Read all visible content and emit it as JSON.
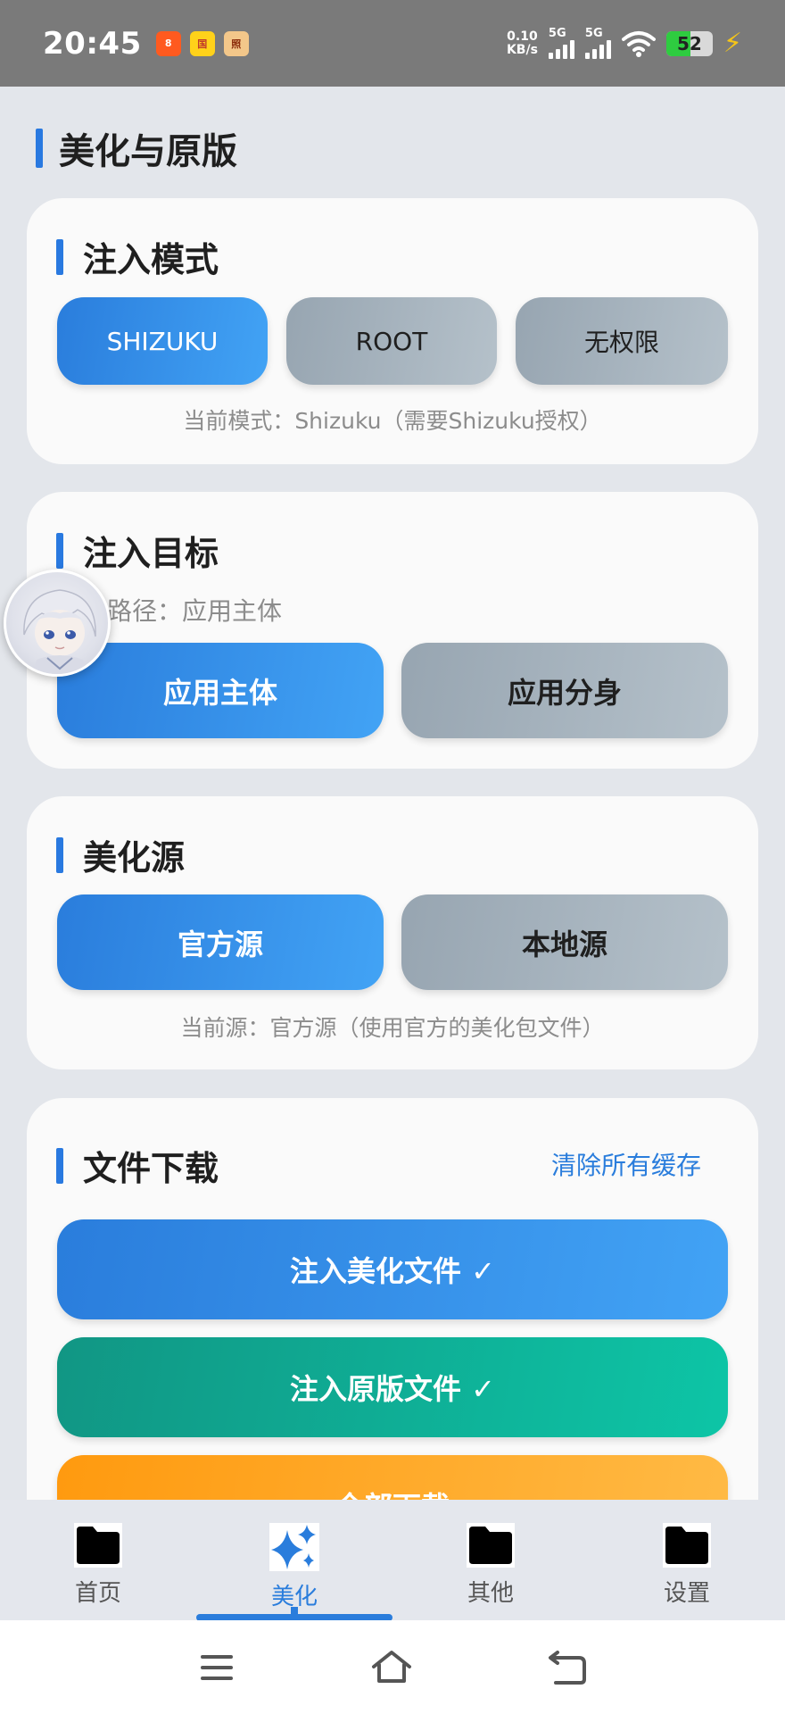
{
  "status_bar": {
    "time": "20:45",
    "apps": [
      "8",
      "国",
      "照"
    ],
    "net_speed_value": "0.10",
    "net_speed_unit": "KB/s",
    "sim1": "5G",
    "sim2": "5G",
    "battery": "52"
  },
  "page_title": "美化与原版",
  "inject_mode": {
    "title": "注入模式",
    "options": [
      "SHIZUKU",
      "ROOT",
      "无权限"
    ],
    "selected": "SHIZUKU",
    "hint": "当前模式：Shizuku（需要Shizuku授权）"
  },
  "inject_target": {
    "title": "注入目标",
    "path_hint": "路径：应用主体",
    "options": [
      "应用主体",
      "应用分身"
    ],
    "selected": "应用主体"
  },
  "beautify_source": {
    "title": "美化源",
    "options": [
      "官方源",
      "本地源"
    ],
    "selected": "官方源",
    "hint": "当前源：官方源（使用官方的美化包文件）"
  },
  "file_download": {
    "title": "文件下载",
    "clear_cache": "清除所有缓存",
    "inject_beautify": "注入美化文件 ✓",
    "inject_original": "注入原版文件 ✓",
    "download_all": "全部下载"
  },
  "bottom_nav": {
    "items": [
      "首页",
      "美化",
      "其他",
      "设置"
    ],
    "active": "美化"
  },
  "colors": {
    "accent": "#2a7ddc",
    "teal": "#0dc5a6",
    "orange": "#ff9a0f",
    "inactive_button": "#a6b3bd"
  }
}
